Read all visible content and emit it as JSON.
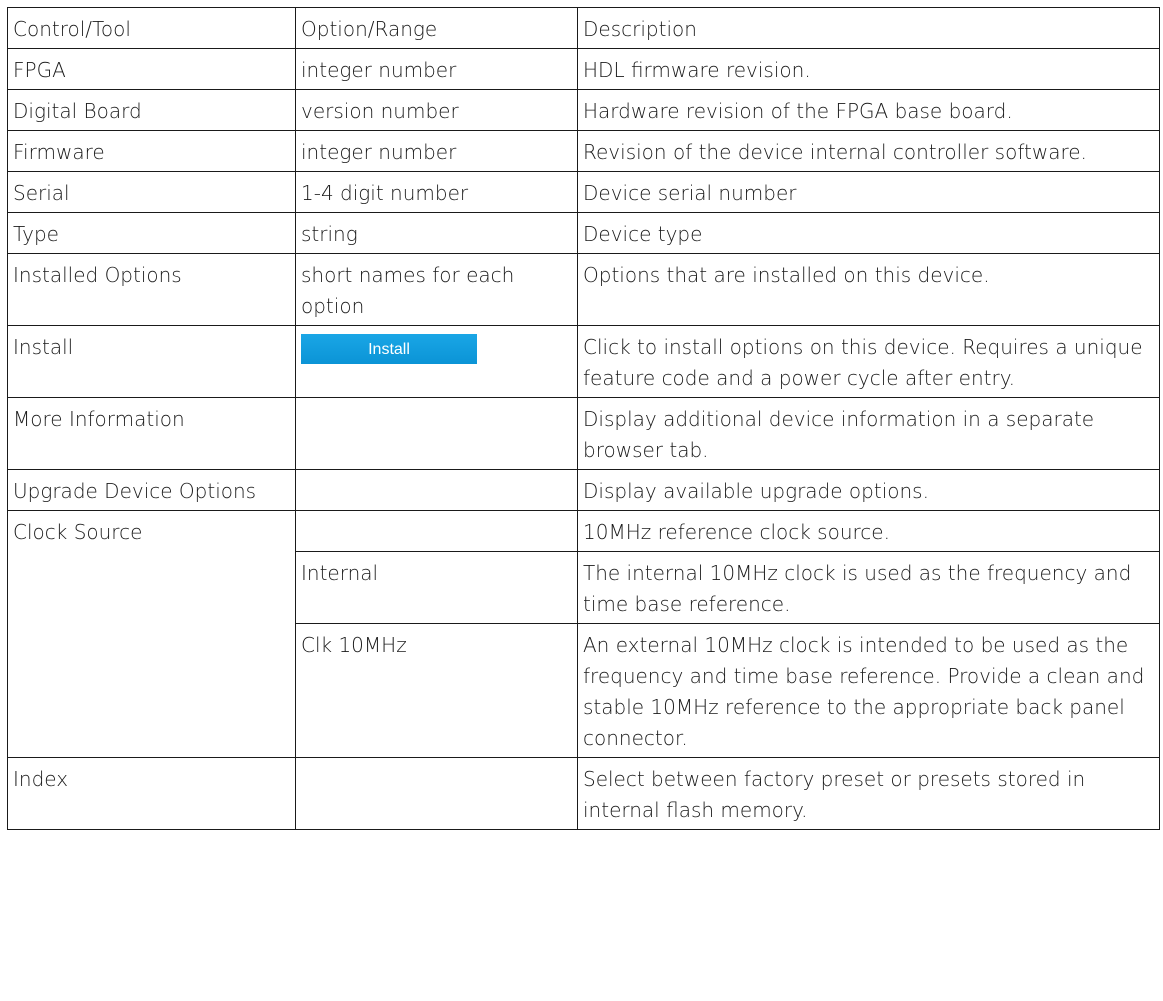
{
  "header": {
    "col1": "Control/Tool",
    "col2": "Option/Range",
    "col3": "Description"
  },
  "rows": [
    {
      "control": "FPGA",
      "option": "integer number",
      "description": "HDL firmware revision."
    },
    {
      "control": "Digital Board",
      "option": "version number",
      "description": "Hardware revision of the FPGA base board."
    },
    {
      "control": "Firmware",
      "option": "integer number",
      "description": "Revision of the device internal controller software."
    },
    {
      "control": "Serial",
      "option": "1-4 digit number",
      "description": "Device serial number"
    },
    {
      "control": "Type",
      "option": "string",
      "description": "Device type"
    },
    {
      "control": "Installed Options",
      "option": "short names for each option",
      "description": "Options that are installed on this device."
    },
    {
      "control": "Install",
      "option_button": "Install",
      "description": "Click to install options on this device. Requires a unique feature code and a power cycle after entry."
    },
    {
      "control": "More Information",
      "option": "",
      "description": "Display additional device information in a separate browser tab."
    },
    {
      "control": "Upgrade Device Options",
      "option": "",
      "description": "Display available upgrade options."
    },
    {
      "control": "Clock Source",
      "option": "",
      "description": "10MHz reference clock source."
    },
    {
      "option": "Internal",
      "description": "The internal 10MHz clock is used as the frequency and time base reference."
    },
    {
      "option": "Clk 10MHz",
      "description": "An external 10MHz clock is intended to be used as the frequency and time base reference. Provide a clean and stable 10MHz reference to the appropriate back panel connector."
    },
    {
      "control": "Index",
      "option": "",
      "description": "Select between factory preset or presets stored in internal flash memory."
    }
  ],
  "colors": {
    "install_button": "#0b94d6",
    "border": "#1a1a1a"
  }
}
